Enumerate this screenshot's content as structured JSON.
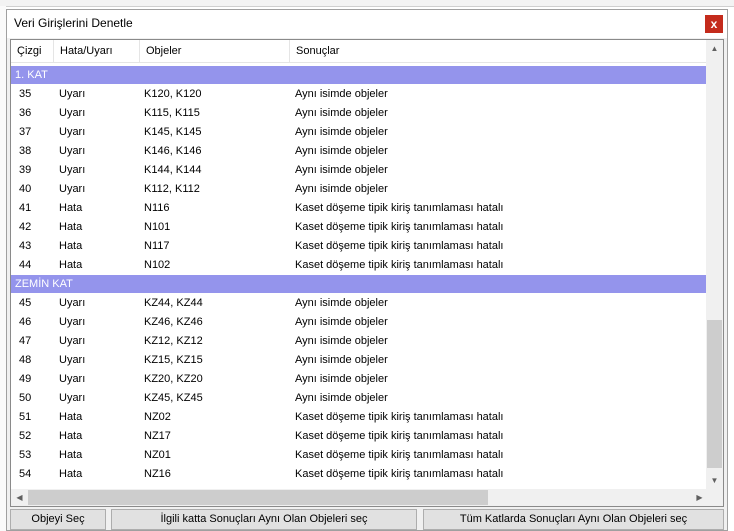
{
  "dialog": {
    "title": "Veri Girişlerini Denetle",
    "close_label": "x"
  },
  "columns": [
    "Çizgi",
    "Hata/Uyarı",
    "Objeler",
    "Sonuçlar"
  ],
  "groups": [
    {
      "name": "1. KAT",
      "rows": [
        [
          "35",
          "Uyarı",
          "K120, K120",
          "Aynı isimde objeler"
        ],
        [
          "36",
          "Uyarı",
          "K115, K115",
          "Aynı isimde objeler"
        ],
        [
          "37",
          "Uyarı",
          "K145, K145",
          "Aynı isimde objeler"
        ],
        [
          "38",
          "Uyarı",
          "K146, K146",
          "Aynı isimde objeler"
        ],
        [
          "39",
          "Uyarı",
          "K144, K144",
          "Aynı isimde objeler"
        ],
        [
          "40",
          "Uyarı",
          "K112, K112",
          "Aynı isimde objeler"
        ],
        [
          "41",
          "Hata",
          "N116",
          "Kaset döşeme tipik kiriş tanımlaması hatalı"
        ],
        [
          "42",
          "Hata",
          "N101",
          "Kaset döşeme tipik kiriş tanımlaması hatalı"
        ],
        [
          "43",
          "Hata",
          "N117",
          "Kaset döşeme tipik kiriş tanımlaması hatalı"
        ],
        [
          "44",
          "Hata",
          "N102",
          "Kaset döşeme tipik kiriş tanımlaması hatalı"
        ]
      ]
    },
    {
      "name": "ZEMİN KAT",
      "rows": [
        [
          "45",
          "Uyarı",
          "KZ44, KZ44",
          "Aynı isimde objeler"
        ],
        [
          "46",
          "Uyarı",
          "KZ46, KZ46",
          "Aynı isimde objeler"
        ],
        [
          "47",
          "Uyarı",
          "KZ12, KZ12",
          "Aynı isimde objeler"
        ],
        [
          "48",
          "Uyarı",
          "KZ15, KZ15",
          "Aynı isimde objeler"
        ],
        [
          "49",
          "Uyarı",
          "KZ20, KZ20",
          "Aynı isimde objeler"
        ],
        [
          "50",
          "Uyarı",
          "KZ45, KZ45",
          "Aynı isimde objeler"
        ],
        [
          "51",
          "Hata",
          "NZ02",
          "Kaset döşeme tipik kiriş tanımlaması hatalı"
        ],
        [
          "52",
          "Hata",
          "NZ17",
          "Kaset döşeme tipik kiriş tanımlaması hatalı"
        ],
        [
          "53",
          "Hata",
          "NZ01",
          "Kaset döşeme tipik kiriş tanımlaması hatalı"
        ],
        [
          "54",
          "Hata",
          "NZ16",
          "Kaset döşeme tipik kiriş tanımlaması hatalı"
        ]
      ]
    }
  ],
  "buttons": {
    "select_object": "Objeyi Seç",
    "select_same_floor": "İlgili katta Sonuçları Aynı Olan Objeleri seç",
    "select_all_floors": "Tüm Katlarda Sonuçları Aynı Olan Objeleri seç"
  },
  "colors": {
    "group_header": "#9494ec",
    "close_button": "#c42b1c"
  },
  "icons": {
    "scroll_up": "▲",
    "scroll_down": "▼",
    "scroll_left": "◀",
    "scroll_right": "▶"
  }
}
